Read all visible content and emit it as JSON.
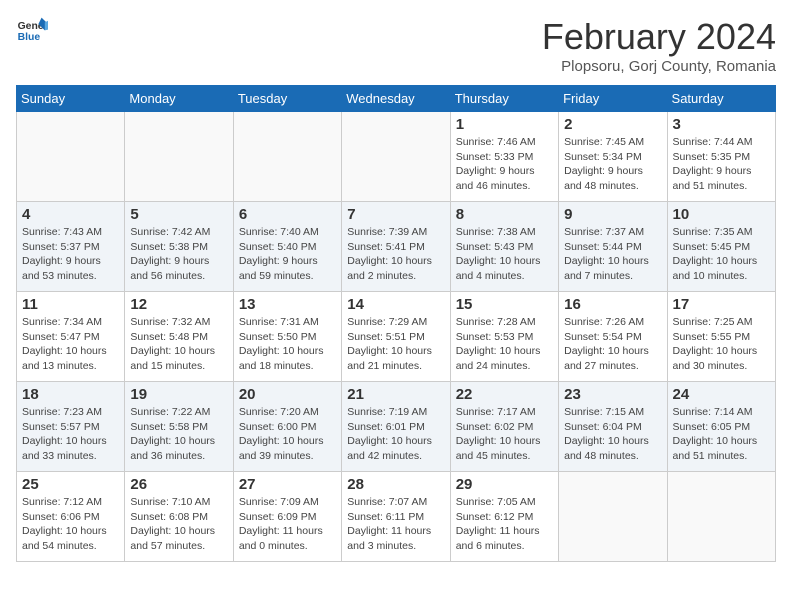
{
  "header": {
    "logo_line1": "General",
    "logo_line2": "Blue",
    "month_title": "February 2024",
    "subtitle": "Plopsoru, Gorj County, Romania"
  },
  "weekdays": [
    "Sunday",
    "Monday",
    "Tuesday",
    "Wednesday",
    "Thursday",
    "Friday",
    "Saturday"
  ],
  "weeks": [
    [
      {
        "day": "",
        "info": ""
      },
      {
        "day": "",
        "info": ""
      },
      {
        "day": "",
        "info": ""
      },
      {
        "day": "",
        "info": ""
      },
      {
        "day": "1",
        "info": "Sunrise: 7:46 AM\nSunset: 5:33 PM\nDaylight: 9 hours\nand 46 minutes."
      },
      {
        "day": "2",
        "info": "Sunrise: 7:45 AM\nSunset: 5:34 PM\nDaylight: 9 hours\nand 48 minutes."
      },
      {
        "day": "3",
        "info": "Sunrise: 7:44 AM\nSunset: 5:35 PM\nDaylight: 9 hours\nand 51 minutes."
      }
    ],
    [
      {
        "day": "4",
        "info": "Sunrise: 7:43 AM\nSunset: 5:37 PM\nDaylight: 9 hours\nand 53 minutes."
      },
      {
        "day": "5",
        "info": "Sunrise: 7:42 AM\nSunset: 5:38 PM\nDaylight: 9 hours\nand 56 minutes."
      },
      {
        "day": "6",
        "info": "Sunrise: 7:40 AM\nSunset: 5:40 PM\nDaylight: 9 hours\nand 59 minutes."
      },
      {
        "day": "7",
        "info": "Sunrise: 7:39 AM\nSunset: 5:41 PM\nDaylight: 10 hours\nand 2 minutes."
      },
      {
        "day": "8",
        "info": "Sunrise: 7:38 AM\nSunset: 5:43 PM\nDaylight: 10 hours\nand 4 minutes."
      },
      {
        "day": "9",
        "info": "Sunrise: 7:37 AM\nSunset: 5:44 PM\nDaylight: 10 hours\nand 7 minutes."
      },
      {
        "day": "10",
        "info": "Sunrise: 7:35 AM\nSunset: 5:45 PM\nDaylight: 10 hours\nand 10 minutes."
      }
    ],
    [
      {
        "day": "11",
        "info": "Sunrise: 7:34 AM\nSunset: 5:47 PM\nDaylight: 10 hours\nand 13 minutes."
      },
      {
        "day": "12",
        "info": "Sunrise: 7:32 AM\nSunset: 5:48 PM\nDaylight: 10 hours\nand 15 minutes."
      },
      {
        "day": "13",
        "info": "Sunrise: 7:31 AM\nSunset: 5:50 PM\nDaylight: 10 hours\nand 18 minutes."
      },
      {
        "day": "14",
        "info": "Sunrise: 7:29 AM\nSunset: 5:51 PM\nDaylight: 10 hours\nand 21 minutes."
      },
      {
        "day": "15",
        "info": "Sunrise: 7:28 AM\nSunset: 5:53 PM\nDaylight: 10 hours\nand 24 minutes."
      },
      {
        "day": "16",
        "info": "Sunrise: 7:26 AM\nSunset: 5:54 PM\nDaylight: 10 hours\nand 27 minutes."
      },
      {
        "day": "17",
        "info": "Sunrise: 7:25 AM\nSunset: 5:55 PM\nDaylight: 10 hours\nand 30 minutes."
      }
    ],
    [
      {
        "day": "18",
        "info": "Sunrise: 7:23 AM\nSunset: 5:57 PM\nDaylight: 10 hours\nand 33 minutes."
      },
      {
        "day": "19",
        "info": "Sunrise: 7:22 AM\nSunset: 5:58 PM\nDaylight: 10 hours\nand 36 minutes."
      },
      {
        "day": "20",
        "info": "Sunrise: 7:20 AM\nSunset: 6:00 PM\nDaylight: 10 hours\nand 39 minutes."
      },
      {
        "day": "21",
        "info": "Sunrise: 7:19 AM\nSunset: 6:01 PM\nDaylight: 10 hours\nand 42 minutes."
      },
      {
        "day": "22",
        "info": "Sunrise: 7:17 AM\nSunset: 6:02 PM\nDaylight: 10 hours\nand 45 minutes."
      },
      {
        "day": "23",
        "info": "Sunrise: 7:15 AM\nSunset: 6:04 PM\nDaylight: 10 hours\nand 48 minutes."
      },
      {
        "day": "24",
        "info": "Sunrise: 7:14 AM\nSunset: 6:05 PM\nDaylight: 10 hours\nand 51 minutes."
      }
    ],
    [
      {
        "day": "25",
        "info": "Sunrise: 7:12 AM\nSunset: 6:06 PM\nDaylight: 10 hours\nand 54 minutes."
      },
      {
        "day": "26",
        "info": "Sunrise: 7:10 AM\nSunset: 6:08 PM\nDaylight: 10 hours\nand 57 minutes."
      },
      {
        "day": "27",
        "info": "Sunrise: 7:09 AM\nSunset: 6:09 PM\nDaylight: 11 hours\nand 0 minutes."
      },
      {
        "day": "28",
        "info": "Sunrise: 7:07 AM\nSunset: 6:11 PM\nDaylight: 11 hours\nand 3 minutes."
      },
      {
        "day": "29",
        "info": "Sunrise: 7:05 AM\nSunset: 6:12 PM\nDaylight: 11 hours\nand 6 minutes."
      },
      {
        "day": "",
        "info": ""
      },
      {
        "day": "",
        "info": ""
      }
    ]
  ]
}
